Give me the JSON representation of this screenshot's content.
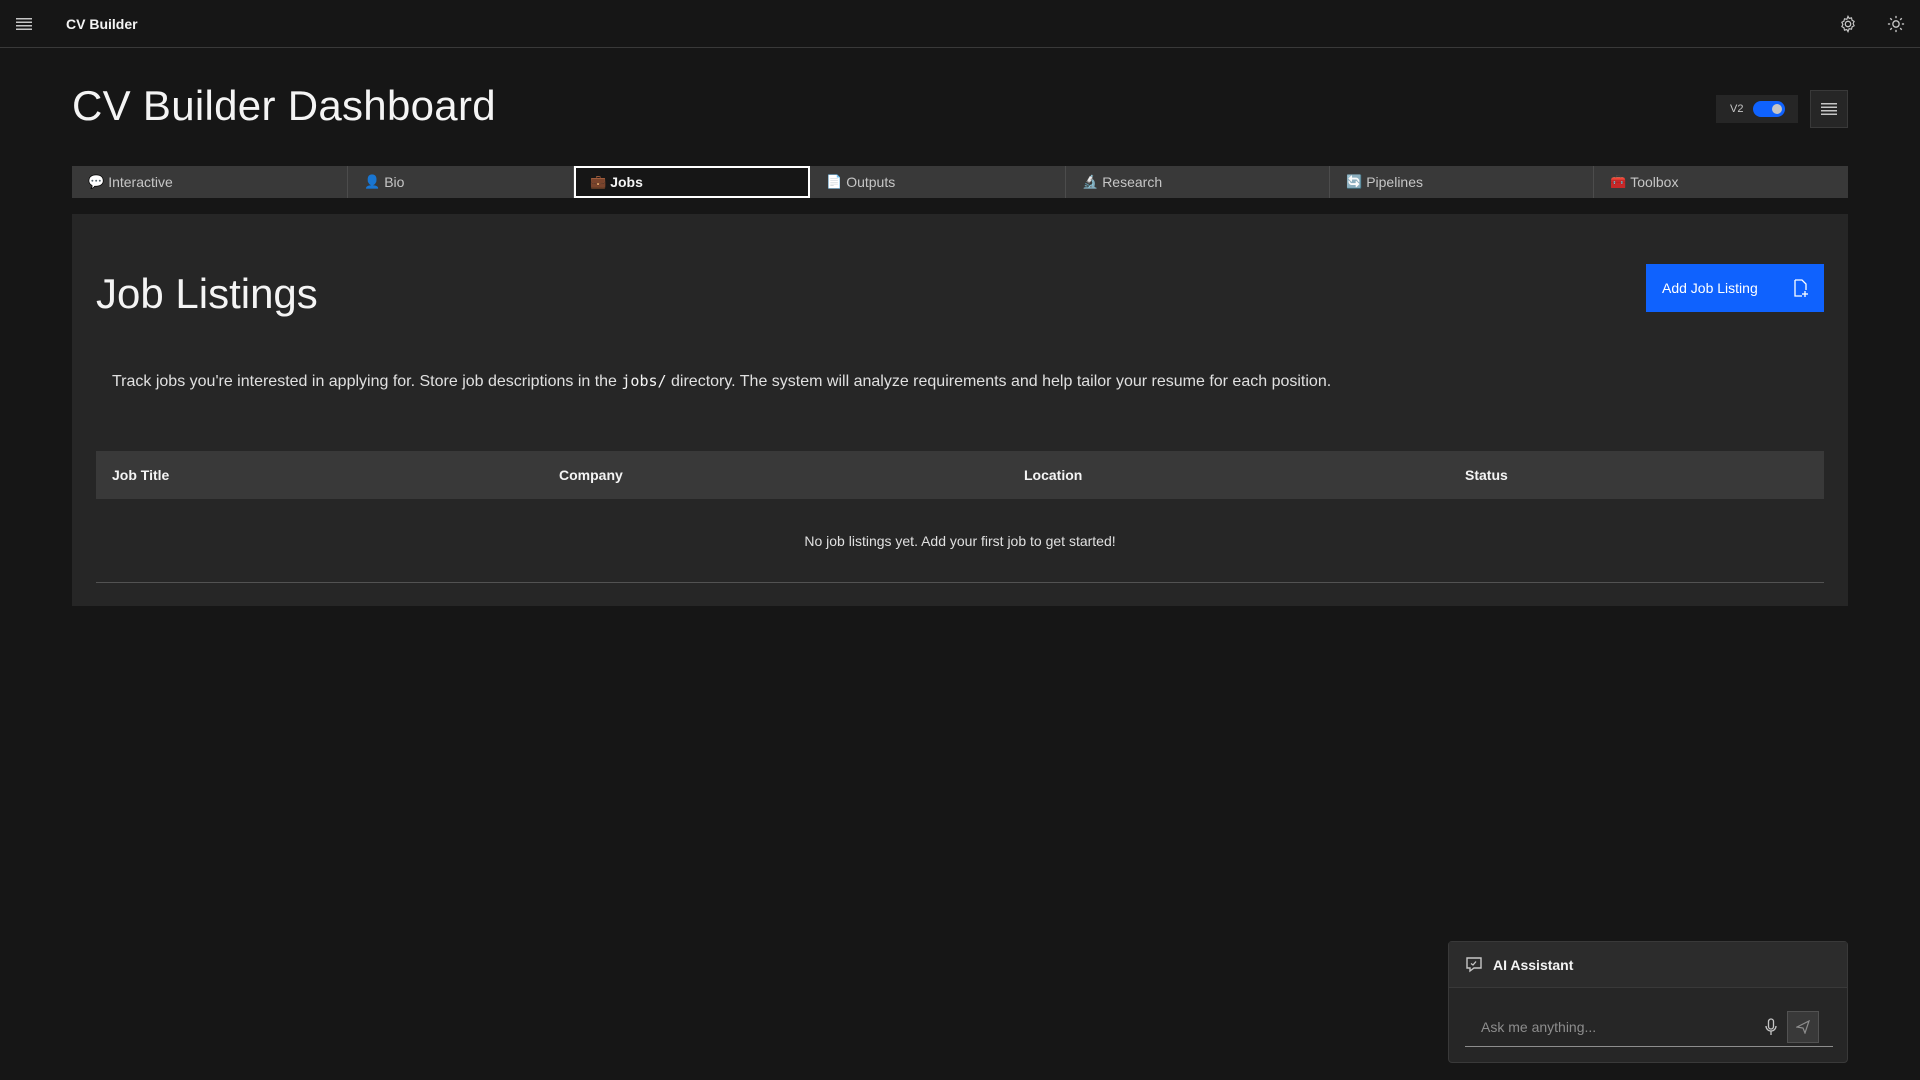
{
  "app": {
    "name": "CV Builder"
  },
  "header": {
    "title": "CV Builder Dashboard",
    "version_label": "V2"
  },
  "tabs": [
    {
      "icon": "💬",
      "label": "Interactive"
    },
    {
      "icon": "👤",
      "label": "Bio"
    },
    {
      "icon": "💼",
      "label": "Jobs"
    },
    {
      "icon": "📄",
      "label": "Outputs"
    },
    {
      "icon": "🔬",
      "label": "Research"
    },
    {
      "icon": "🔄",
      "label": "Pipelines"
    },
    {
      "icon": "🧰",
      "label": "Toolbox"
    }
  ],
  "active_tab": "Jobs",
  "jobs": {
    "title": "Job Listings",
    "add_button": "Add Job Listing",
    "description_before": "Track jobs you're interested in applying for. Store job descriptions in the ",
    "description_code": "jobs/",
    "description_after": " directory. The system will analyze requirements and help tailor your resume for each position.",
    "columns": [
      "Job Title",
      "Company",
      "Location",
      "Status"
    ],
    "empty_message": "No job listings yet. Add your first job to get started!"
  },
  "assistant": {
    "title": "AI Assistant",
    "placeholder": "Ask me anything..."
  },
  "colors": {
    "background": "#161616",
    "panel": "#262626",
    "accent": "#0f62fe"
  }
}
